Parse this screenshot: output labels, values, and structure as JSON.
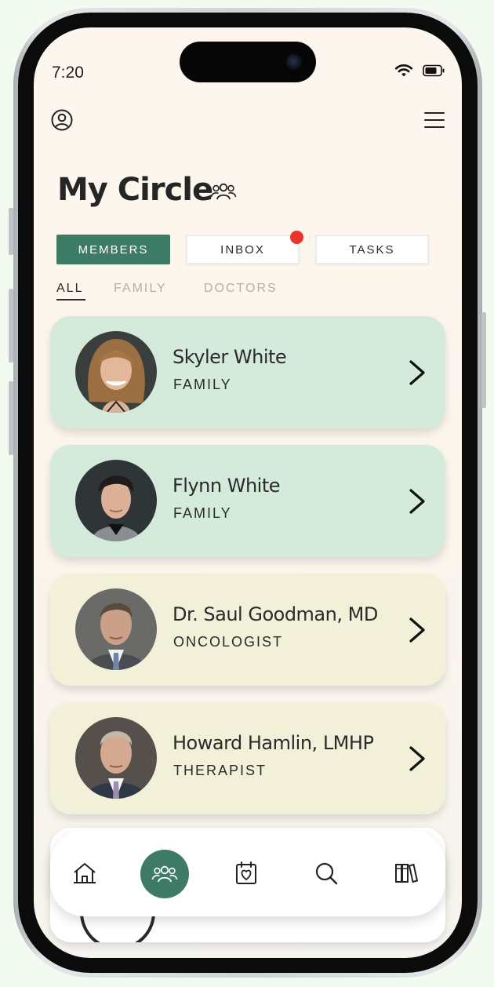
{
  "status_bar": {
    "time": "7:20"
  },
  "header": {
    "profile_icon": "user-circle-icon",
    "menu_icon": "hamburger-menu-icon"
  },
  "page": {
    "title": "My Circle",
    "title_icon": "people-group-icon"
  },
  "segments": [
    {
      "label": "MEMBERS",
      "active": true
    },
    {
      "label": "INBOX",
      "active": false,
      "has_notification": true
    },
    {
      "label": "TASKS",
      "active": false
    }
  ],
  "filters": [
    {
      "label": "ALL",
      "active": true
    },
    {
      "label": "FAMILY",
      "active": false
    },
    {
      "label": "DOCTORS",
      "active": false
    }
  ],
  "members": [
    {
      "name": "Skyler White",
      "role": "FAMILY",
      "card_color": "#d4eadb"
    },
    {
      "name": "Flynn White",
      "role": "FAMILY",
      "card_color": "#d4eadb"
    },
    {
      "name": "Dr. Saul Goodman, MD",
      "role": "ONCOLOGIST",
      "card_color": "#f2f0d8"
    },
    {
      "name": "Howard Hamlin, LMHP",
      "role": "THERAPIST",
      "card_color": "#f2f0d8"
    }
  ],
  "tab_bar": {
    "items": [
      {
        "icon": "home-icon",
        "active": false
      },
      {
        "icon": "people-group-icon",
        "active": true
      },
      {
        "icon": "calendar-heart-icon",
        "active": false
      },
      {
        "icon": "search-icon",
        "active": false
      },
      {
        "icon": "library-books-icon",
        "active": false
      }
    ]
  },
  "colors": {
    "accent": "#3d7b67",
    "notification": "#e8352c",
    "family_card": "#d4eadb",
    "doctor_card": "#f2f0d8"
  }
}
